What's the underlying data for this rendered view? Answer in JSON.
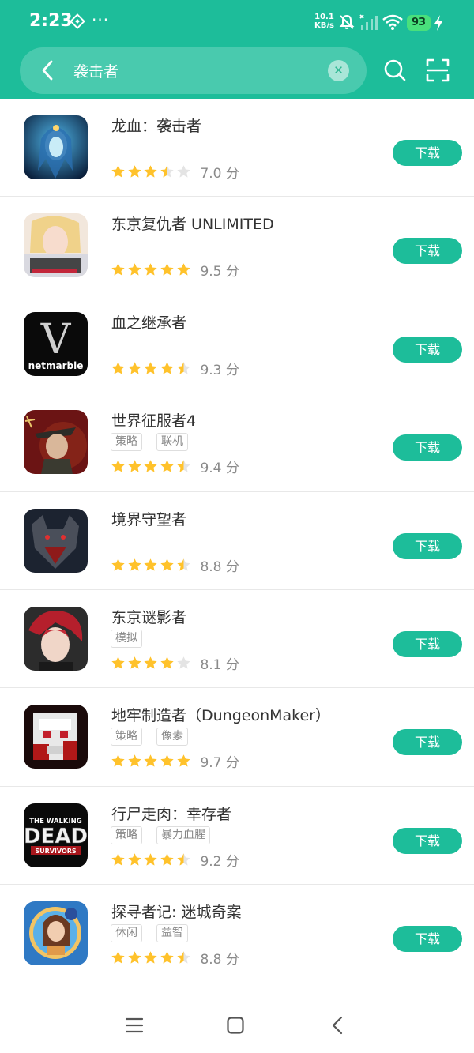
{
  "status": {
    "time": "2:23",
    "dots": "···",
    "speed_value": "10.1",
    "speed_unit": "KB/s",
    "battery": "93"
  },
  "search": {
    "query": "袭击者"
  },
  "download_label": "下载",
  "score_unit": "分",
  "apps": [
    {
      "name": "龙血：袭击者",
      "rating": 3.5,
      "score": "7.0",
      "tags": []
    },
    {
      "name": "东京复仇者 UNLIMITED",
      "rating": 5,
      "score": "9.5",
      "tags": []
    },
    {
      "name": "血之继承者",
      "rating": 4.5,
      "score": "9.3",
      "tags": []
    },
    {
      "name": "世界征服者4",
      "rating": 4.5,
      "score": "9.4",
      "tags": [
        "策略",
        "联机"
      ]
    },
    {
      "name": "境界守望者",
      "rating": 4.5,
      "score": "8.8",
      "tags": []
    },
    {
      "name": "东京谜影者",
      "rating": 4,
      "score": "8.1",
      "tags": [
        "模拟"
      ]
    },
    {
      "name": "地牢制造者（DungeonMaker）",
      "rating": 5,
      "score": "9.7",
      "tags": [
        "策略",
        "像素"
      ]
    },
    {
      "name": "行尸走肉：幸存者",
      "rating": 4.5,
      "score": "9.2",
      "tags": [
        "策略",
        "暴力血腥"
      ]
    },
    {
      "name": "探寻者记: 迷城奇案",
      "rating": 4.5,
      "score": "8.8",
      "tags": [
        "休闲",
        "益智"
      ]
    }
  ],
  "icon_texts": {
    "blood_logo": "V",
    "blood_brand": "netmarble",
    "walking_top": "THE WALKING",
    "walking_main": "DEAD",
    "walking_sub": "SURVIVORS"
  },
  "colors": {
    "brand": "#1dbd9a",
    "star": "#ffc22b",
    "star_empty": "#e4e4e4"
  }
}
